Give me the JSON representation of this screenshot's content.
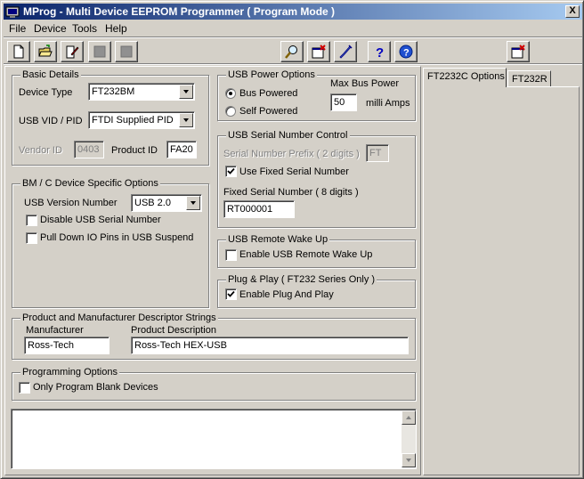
{
  "window": {
    "title": "MProg - Multi Device EEPROM Programmer ( Program Mode )",
    "close_glyph": "X"
  },
  "menu": {
    "file": "File",
    "device": "Device",
    "tools": "Tools",
    "help": "Help"
  },
  "toolbar": {
    "icons": [
      "new-file-icon",
      "open-folder-icon",
      "edit-icon",
      "stop-icon",
      "stop-icon",
      "search-icon",
      "erase-icon",
      "program-icon",
      "help-icon",
      "about-icon",
      "close-window-icon"
    ]
  },
  "basic": {
    "title": "Basic Details",
    "device_type_label": "Device Type",
    "device_type_value": "FT232BM",
    "vidpid_label": "USB VID / PID",
    "vidpid_value": "FTDI Supplied PID",
    "vendor_id_label": "Vendor ID",
    "vendor_id_value": "0403",
    "product_id_label": "Product ID",
    "product_id_value": "FA20"
  },
  "bmc": {
    "title": "BM / C Device Specific Options",
    "usb_version_label": "USB Version Number",
    "usb_version_value": "USB 2.0",
    "disable_serial_label": "Disable USB Serial Number",
    "disable_serial_checked": false,
    "pull_down_label": "Pull Down IO Pins in USB Suspend",
    "pull_down_checked": false
  },
  "power": {
    "title": "USB Power Options",
    "bus_powered_label": "Bus Powered",
    "self_powered_label": "Self Powered",
    "selected": "bus",
    "max_bus_label": "Max Bus Power",
    "max_bus_value": "50",
    "milliamps_label": "milli Amps"
  },
  "serial": {
    "title": "USB Serial Number Control",
    "prefix_label": "Serial Number Prefix ( 2 digits )",
    "prefix_value": "FT",
    "use_fixed_label": "Use Fixed Serial Number",
    "use_fixed_checked": true,
    "fixed_label": "Fixed Serial Number ( 8 digits )",
    "fixed_value": "RT000001"
  },
  "wakeup": {
    "title": "USB Remote Wake Up",
    "enable_label": "Enable USB Remote Wake Up",
    "checked": false
  },
  "pnp": {
    "title": "Plug & Play  ( FT232 Series Only )",
    "enable_label": "Enable Plug And Play",
    "checked": true
  },
  "strings": {
    "title": "Product and Manufacturer Descriptor Strings",
    "manufacturer_label": "Manufacturer",
    "manufacturer_value": "Ross-Tech",
    "product_label": "Product Description",
    "product_value": "Ross-Tech HEX-USB"
  },
  "programming": {
    "title": "Programming Options",
    "blank_only_label": "Only Program Blank Devices",
    "checked": false
  },
  "tabs": {
    "tab1": "FT2232C Options",
    "tab2": "FT232R"
  }
}
